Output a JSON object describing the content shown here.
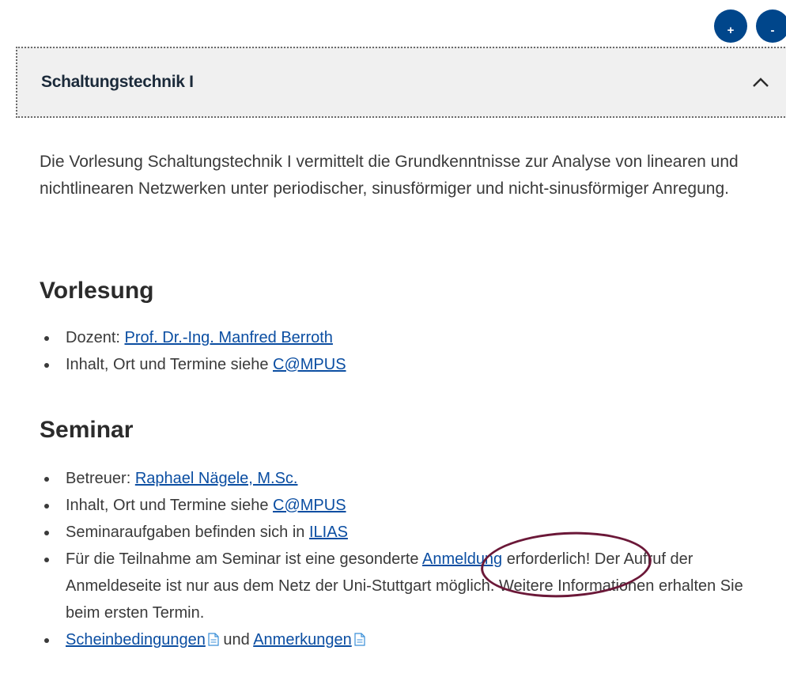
{
  "zoom": {
    "plus_label": "+",
    "minus_label": "-"
  },
  "accordion": {
    "title": "Schaltungstechnik I"
  },
  "intro": "Die Vorlesung Schaltungstechnik I vermittelt die Grundkenntnisse zur Analyse von linearen und nichtlinearen Netzwerken unter periodischer, sinusförmiger und nicht-sinusförmiger Anregung.",
  "vorlesung": {
    "heading": "Vorlesung",
    "dozent_prefix": "Dozent: ",
    "dozent_link": "Prof. Dr.-Ing. Manfred Berroth",
    "inhalt_prefix": "Inhalt, Ort und Termine siehe ",
    "campus_link": "C@MPUS"
  },
  "seminar": {
    "heading": "Seminar",
    "betreuer_prefix": "Betreuer: ",
    "betreuer_link": "Raphael Nägele, M.Sc.",
    "inhalt_prefix": "Inhalt, Ort und Termine siehe ",
    "campus_link": "C@MPUS",
    "aufgaben_prefix": "Seminaraufgaben befinden sich in ",
    "ilias_link": "ILIAS",
    "teilnahme_prefix": "Für die Teilnahme am Seminar ist eine gesonderte ",
    "anmeldung_link": "Anmeldung",
    "teilnahme_suffix": " erforderlich! Der Aufruf der Anmeldeseite ist nur aus dem Netz der Uni-Stuttgart möglich. Weitere Informationen erhalten Sie beim ersten Termin.",
    "schein_link": "Scheinbedingungen",
    "und_text": " und ",
    "anmerkungen_link": "Anmerkungen"
  },
  "colors": {
    "link": "#0b4ea2",
    "zoom_button": "#00468b",
    "highlight": "#6b1838",
    "header_bg": "#f0f0f0"
  },
  "icons": {
    "expand": "chevron-up-icon",
    "document": "pdf-icon"
  }
}
